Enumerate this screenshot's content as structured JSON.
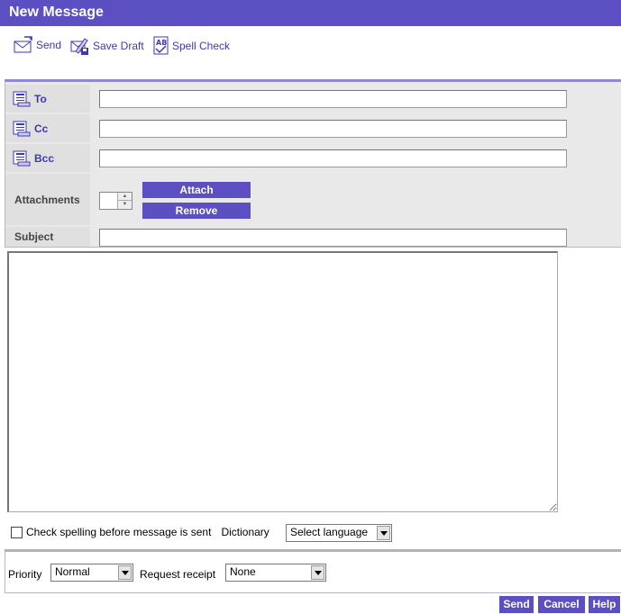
{
  "window": {
    "title": "New Message"
  },
  "toolbar": {
    "send_label": "Send",
    "save_draft_label": "Save Draft",
    "spell_check_label": "Spell Check"
  },
  "fields": {
    "to_label": "To",
    "cc_label": "Cc",
    "bcc_label": "Bcc",
    "attachments_label": "Attachments",
    "subject_label": "Subject",
    "to_value": "",
    "cc_value": "",
    "bcc_value": "",
    "subject_value": ""
  },
  "attachments": {
    "attach_label": "Attach",
    "remove_label": "Remove"
  },
  "message": {
    "body": ""
  },
  "options": {
    "check_spelling_label": "Check spelling before message is sent",
    "check_spelling_checked": false,
    "dictionary_label": "Dictionary",
    "dictionary_value": "Select language",
    "priority_label": "Priority",
    "priority_value": "Normal",
    "receipt_label": "Request receipt",
    "receipt_value": "None"
  },
  "actions": {
    "send_label": "Send",
    "cancel_label": "Cancel",
    "help_label": "Help"
  },
  "colors": {
    "accent": "#5b4fc2",
    "link": "#3d3ab0",
    "panel": "#e9e9e9"
  }
}
